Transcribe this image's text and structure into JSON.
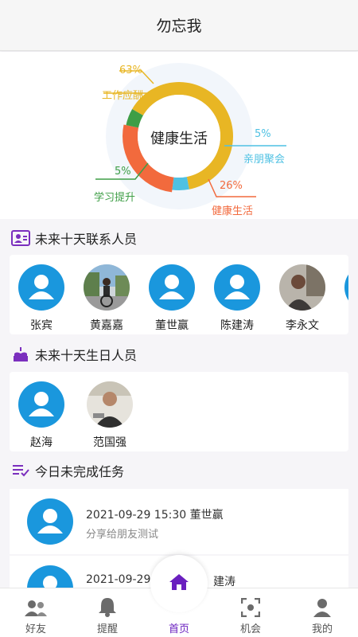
{
  "header": {
    "title": "勿忘我"
  },
  "chart_data": {
    "type": "pie",
    "title": "健康生活",
    "slices": [
      {
        "label": "工作应酬",
        "value": 63,
        "pct_text": "63%",
        "color": "#e8b624"
      },
      {
        "label": "亲朋聚会",
        "value": 5,
        "pct_text": "5%",
        "color": "#4fc1e3"
      },
      {
        "label": "健康生活",
        "value": 26,
        "pct_text": "26%",
        "color": "#f26a3d"
      },
      {
        "label": "学习提升",
        "value": 5,
        "pct_text": "5%",
        "color": "#3e9e46"
      }
    ]
  },
  "contacts": {
    "title": "未来十天联系人员",
    "people": [
      {
        "name": "张宾",
        "avatar": "default"
      },
      {
        "name": "黄嘉嘉",
        "avatar": "photo"
      },
      {
        "name": "董世赢",
        "avatar": "default"
      },
      {
        "name": "陈建涛",
        "avatar": "default"
      },
      {
        "name": "李永文",
        "avatar": "photo"
      }
    ]
  },
  "birthdays": {
    "title": "未来十天生日人员",
    "people": [
      {
        "name": "赵海",
        "avatar": "default"
      },
      {
        "name": "范国强",
        "avatar": "photo"
      }
    ]
  },
  "tasks": {
    "title": "今日未完成任务",
    "items": [
      {
        "datetime_person": "2021-09-29 15:30  董世赢",
        "desc": "分享给朋友测试"
      },
      {
        "datetime_person": "2021-09-29",
        "person_tail": "建涛"
      }
    ]
  },
  "tabbar": {
    "items": [
      {
        "label": "好友",
        "icon": "friends-icon"
      },
      {
        "label": "提醒",
        "icon": "bell-icon"
      },
      {
        "label": "首页",
        "icon": "home-icon"
      },
      {
        "label": "机会",
        "icon": "scan-icon"
      },
      {
        "label": "我的",
        "icon": "user-icon"
      }
    ],
    "accent": "#6a1fbf"
  }
}
